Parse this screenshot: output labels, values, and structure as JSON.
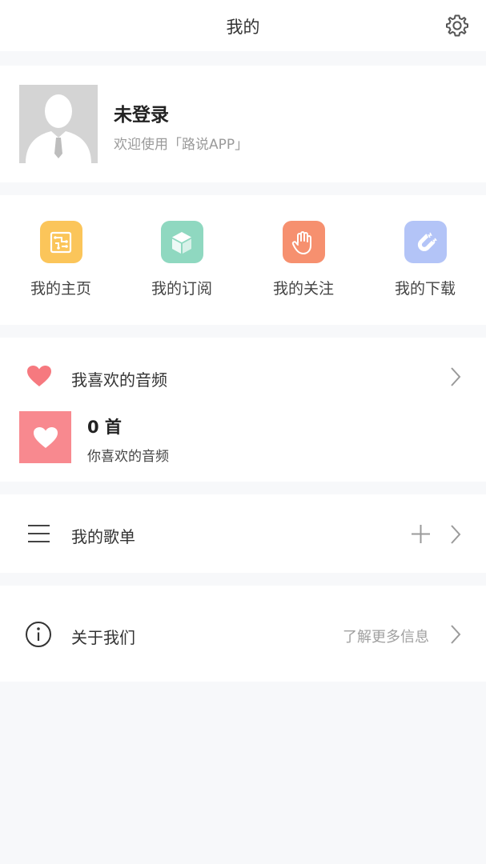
{
  "header": {
    "title": "我的",
    "settings_icon": "gear-icon"
  },
  "profile": {
    "name": "未登录",
    "subtitle": "欢迎使用「路说APP」",
    "avatar_icon": "default-user-avatar"
  },
  "quick_actions": [
    {
      "label": "我的主页",
      "icon": "circuit-board-icon",
      "color": "#fbc55a"
    },
    {
      "label": "我的订阅",
      "icon": "cube-icon",
      "color": "#8fd8c0"
    },
    {
      "label": "我的关注",
      "icon": "hand-icon",
      "color": "#f6906f"
    },
    {
      "label": "我的下载",
      "icon": "magnet-icon",
      "color": "#b3c4f7"
    }
  ],
  "favorites": {
    "title": "我喜欢的音频",
    "count": "0 首",
    "description": "你喜欢的音频",
    "heart_color": "#f6797f",
    "thumb_color": "#f8898f"
  },
  "playlist": {
    "title": "我的歌单",
    "add_icon": "plus-icon"
  },
  "about": {
    "title": "关于我们",
    "hint": "了解更多信息",
    "icon": "info-icon"
  }
}
